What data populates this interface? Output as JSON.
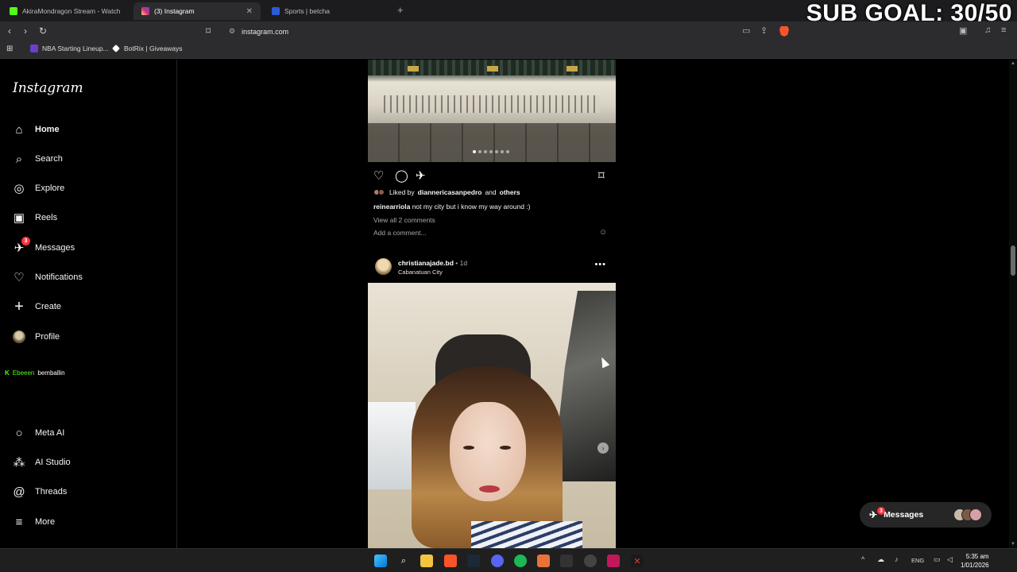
{
  "browser": {
    "tabs": [
      {
        "label": "AkiraMondragon Stream - Watch Live",
        "color": "#53fc18"
      },
      {
        "label": "(3) Instagram",
        "color": "#c13584"
      },
      {
        "label": "Sports | betcha",
        "color": "#2d5bd7"
      }
    ],
    "new_tab": "+",
    "url": "instagram.com",
    "bookmarks": [
      {
        "label": "NBA Starting Lineup...",
        "color": "#6a3fd0"
      },
      {
        "label": "BotRix | Giveaways",
        "color": "#ffffff"
      }
    ]
  },
  "overlay": {
    "sub_goal": "SUB GOAL: 30/50"
  },
  "sidebar": {
    "logo": "Instagram",
    "items": [
      {
        "label": "Home",
        "icon": "home-icon",
        "glyph": "⌂"
      },
      {
        "label": "Search",
        "icon": "search-icon",
        "glyph": "⌕"
      },
      {
        "label": "Explore",
        "icon": "compass-icon",
        "glyph": "◎"
      },
      {
        "label": "Reels",
        "icon": "reels-icon",
        "glyph": "▣"
      },
      {
        "label": "Messages",
        "icon": "messenger-icon",
        "glyph": "✈",
        "badge": "3"
      },
      {
        "label": "Notifications",
        "icon": "heart-icon",
        "glyph": "♡"
      },
      {
        "label": "Create",
        "icon": "plus-icon",
        "glyph": "+"
      },
      {
        "label": "Profile",
        "icon": "profile-avatar",
        "glyph": ""
      }
    ],
    "kick_overlay": {
      "name1": "Ebeeen",
      "name2": "bemballin"
    },
    "bottom_items": [
      {
        "label": "Meta AI",
        "icon": "meta-ai-icon",
        "glyph": "○"
      },
      {
        "label": "AI Studio",
        "icon": "ai-studio-icon",
        "glyph": "⁂"
      },
      {
        "label": "Threads",
        "icon": "threads-icon",
        "glyph": "@"
      },
      {
        "label": "More",
        "icon": "menu-icon",
        "glyph": "≡"
      }
    ]
  },
  "post1": {
    "liked_by_prefix": "Liked by",
    "liked_by_user": "diannericasanpedro",
    "liked_by_and": "and",
    "liked_by_others": "others",
    "caption_user": "reinearriola",
    "caption_text": "not my city but i know my way around :)",
    "view_all": "View all 2 comments",
    "add_comment": "Add a comment..."
  },
  "post2": {
    "username": "christianajade.bd",
    "time": " • 1d",
    "location": "Cabanatuan City"
  },
  "messages_pill": {
    "label": "Messages",
    "badge": "3"
  },
  "taskbar": {
    "lang": "ENG",
    "time": "5:35 am",
    "date": "1/01/2026"
  }
}
